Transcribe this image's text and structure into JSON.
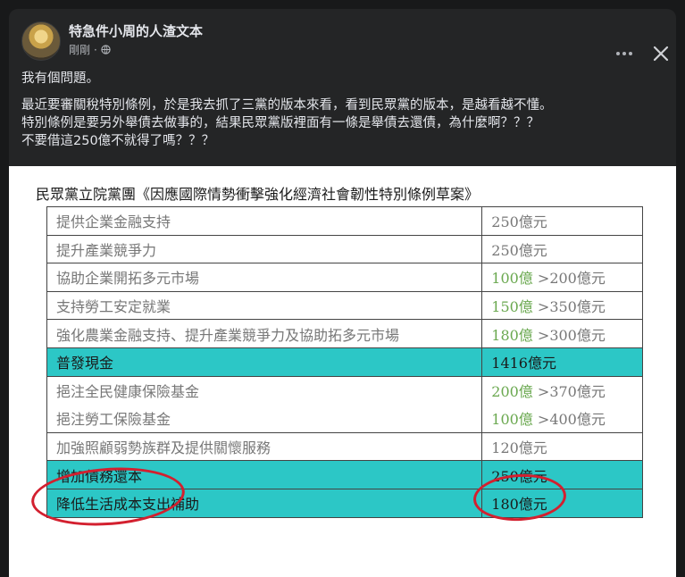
{
  "post": {
    "author": "特急件小周的人渣文本",
    "time": "剛剛",
    "lines": [
      "我有個問題。",
      "最近要審關稅特別條例，於是我去抓了三黨的版本來看，看到民眾黨的版本，是越看越不懂。",
      "特別條例是要另外舉債去做事的，結果民眾黨版裡面有一條是舉債去還債，為什麼啊？？？",
      "不要借這250億不就得了嗎？？？"
    ]
  },
  "image": {
    "title": "民眾黨立院黨團《因應國際情勢衝擊強化經濟社會韌性特別條例草案》",
    "rows": [
      {
        "item": "提供企業金融支持",
        "amount_new": "",
        "amount": "250億元",
        "highlight": false
      },
      {
        "item": "提升產業競爭力",
        "amount_new": "",
        "amount": "250億元",
        "highlight": false
      },
      {
        "item": "協助企業開拓多元市場",
        "amount_new": "100億",
        "amount": ">200億元",
        "highlight": false
      },
      {
        "item": "支持勞工安定就業",
        "amount_new": "150億",
        "amount": ">350億元",
        "highlight": false
      },
      {
        "item": "強化農業金融支持、提升產業競爭力及協助拓多元市場",
        "amount_new": "180億",
        "amount": ">300億元",
        "highlight": false
      },
      {
        "item": "普發現金",
        "amount_new": "",
        "amount": "1416億元",
        "highlight": true
      },
      {
        "item": "挹注全民健康保險基金",
        "amount_new": "200億",
        "amount": ">370億元",
        "highlight": false
      },
      {
        "item": "挹注勞工保險基金",
        "amount_new": "100億",
        "amount": ">400億元",
        "highlight": false
      },
      {
        "item": "加強照顧弱勢族群及提供關懷服務",
        "amount_new": "",
        "amount": "120億元",
        "highlight": false
      },
      {
        "item": "增加債務還本",
        "amount_new": "",
        "amount": "250億元",
        "highlight": true
      },
      {
        "item": "降低生活成本支出補助",
        "amount_new": "",
        "amount": "180億元",
        "highlight": true
      }
    ]
  },
  "colors": {
    "highlight": "#2cc7c6",
    "circle": "#d3202f",
    "green": "#6aa84f"
  }
}
